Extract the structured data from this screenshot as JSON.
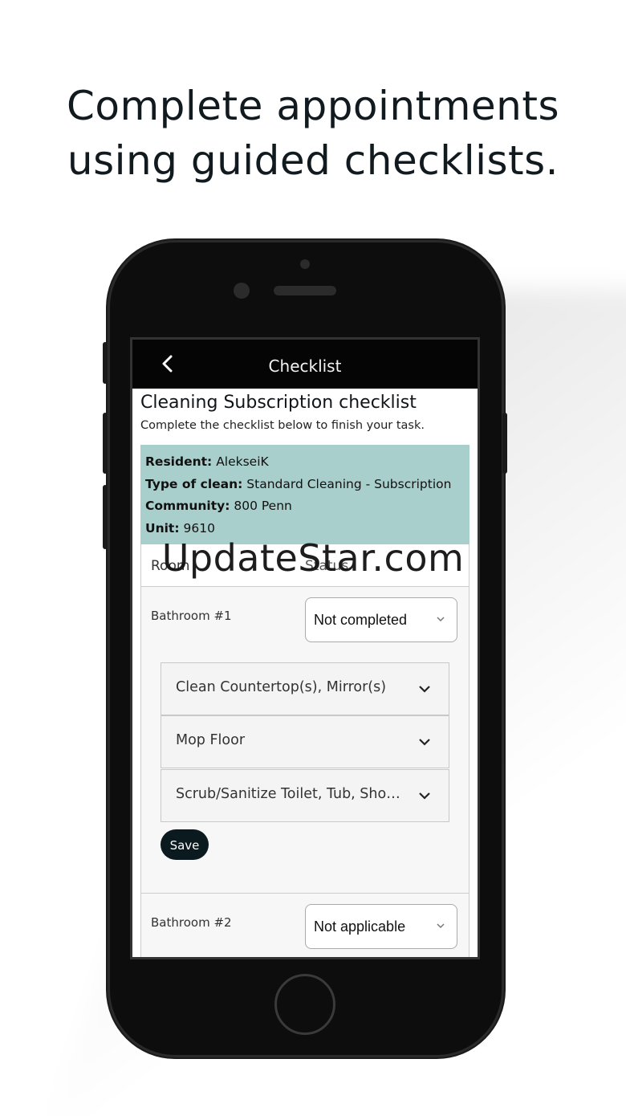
{
  "headline": {
    "line1": "Complete appointments",
    "line2": "using guided checklists."
  },
  "topbar": {
    "back_icon": "chevron-left-icon",
    "title": "Checklist"
  },
  "page": {
    "title": "Cleaning Subscription checklist",
    "subtitle": "Complete the checklist below to finish your task."
  },
  "info": {
    "resident_label": "Resident:",
    "resident_value": "AlekseiK",
    "type_label": "Type of clean:",
    "type_value": "Standard Cleaning - Subscription",
    "community_label": "Community:",
    "community_value": "800 Penn",
    "unit_label": "Unit:",
    "unit_value": "9610",
    "bg_color": "#a9cfcd"
  },
  "table": {
    "col_room": "Room",
    "col_status": "Status",
    "rows": [
      {
        "room": "Bathroom #1",
        "status": "Not completed"
      },
      {
        "room": "Bathroom #2",
        "status": "Not applicable"
      }
    ],
    "tasks": [
      {
        "label": "Clean Countertop(s), Mirror(s)"
      },
      {
        "label": "Mop Floor"
      },
      {
        "label": "Scrub/Sanitize Toilet, Tub, Sho…"
      }
    ],
    "save_label": "Save"
  },
  "watermark": "UpdateStar.com",
  "colors": {
    "topbar": "#050505",
    "save_button": "#0b1a1f"
  }
}
